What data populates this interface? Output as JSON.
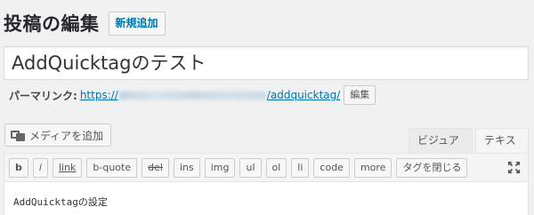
{
  "header": {
    "title": "投稿の編集",
    "add_new_label": "新規追加"
  },
  "post": {
    "title_value": "AddQuicktagのテスト"
  },
  "permalink": {
    "label": "パーマリンク:",
    "url_prefix": "https://",
    "url_suffix": "/addquicktag/",
    "edit_label": "編集"
  },
  "media": {
    "add_media_label": "メディアを追加",
    "icon": "media-icon"
  },
  "editor_tabs": {
    "visual": "ビジュアル",
    "text": "テキスト"
  },
  "quicktags": [
    "b",
    "i",
    "link",
    "b-quote",
    "del",
    "ins",
    "img",
    "ul",
    "ol",
    "li",
    "code",
    "more",
    "タグを閉じる"
  ],
  "content": {
    "text": "AddQuicktagの設定"
  },
  "colors": {
    "accent": "#0073aa",
    "background": "#f1f1f1",
    "text": "#23282d"
  }
}
